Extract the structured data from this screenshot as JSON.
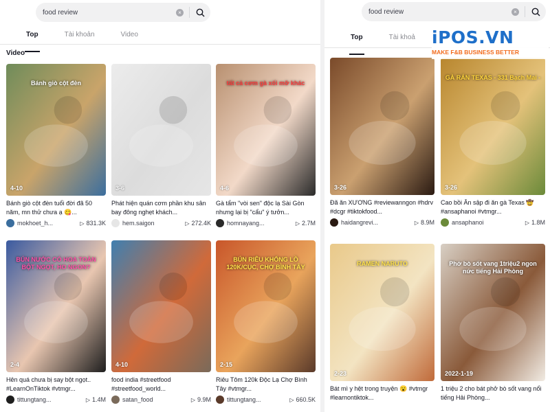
{
  "left": {
    "search": {
      "query": "food review",
      "clear_icon": "×"
    },
    "tabs": [
      "Top",
      "Tài khoản",
      "Video"
    ],
    "section_title": "Video",
    "cards": [
      {
        "duration": "4-10",
        "overlay": "Bánh giò cột đèn",
        "overlay_color": "#ffffff",
        "desc": "Bánh giò cột đèn tuổi đời đã 50 năm, mn thử chưa ạ 😋...",
        "author": "mokhoet_h...",
        "views": "831.3K",
        "colors": [
          "#6f8c5a",
          "#c9a46a",
          "#3b6e9e"
        ]
      },
      {
        "duration": "3-6",
        "overlay": "",
        "overlay_color": "#ffffff",
        "desc": "Phát hiện quán cơm phần khu sân bay đông nghẹt khách...",
        "author": "hem.saigon",
        "views": "272.4K",
        "colors": [
          "#ececec",
          "#dcdcdc",
          "#e6e6e6"
        ]
      },
      {
        "duration": "4-6",
        "overlay": "tất cả cơm gà xối mỡ khác",
        "overlay_color": "#ff3b3b",
        "desc": "Gà tẩm \"vòi sen\" độc lạ Sài Gòn nhưng lại bị \"cẩu\" ý tưởn...",
        "author": "homnayang...",
        "views": "2.7M",
        "colors": [
          "#b89070",
          "#f2d9c8",
          "#2a2a2a"
        ]
      },
      {
        "duration": "2-4",
        "overlay": "BÚN NƯỚC CÓ HOA TOÀN BỘT NGỌT, HO NGON?",
        "overlay_color": "#ff4fa8",
        "desc": "Hên quá chưa bị say bột ngọt.. #LearnOnTiktok #vtmgr...",
        "author": "tittungtang...",
        "views": "1.4M",
        "colors": [
          "#3a5aa0",
          "#e8c6b0",
          "#1e1e1e"
        ]
      },
      {
        "duration": "4-10",
        "overlay": "",
        "overlay_color": "#ffffff",
        "desc": "food india #streetfood #streetfood_world...",
        "author": "satan_food",
        "views": "9.9M",
        "colors": [
          "#3f7fb0",
          "#d06a3a",
          "#7a6a5a"
        ]
      },
      {
        "duration": "2-15",
        "overlay": "BÚN RIÊU KHỔNG LỒ 120K/CỤC, CHỢ BÌNH TÂY",
        "overlay_color": "#ffe14a",
        "desc": "Riêu Tôm 120k Độc Lạ Chợ Bình Tây #vtmgr...",
        "author": "tittungtang...",
        "views": "660.5K",
        "colors": [
          "#c8562a",
          "#e9a45c",
          "#5a3a2a"
        ]
      }
    ]
  },
  "right": {
    "search": {
      "query": "food review",
      "clear_icon": "×"
    },
    "tabs": [
      "Top",
      "Tài khoả"
    ],
    "cards": [
      {
        "duration": "3-26",
        "overlay": "",
        "overlay_color": "#ffffff",
        "desc": "Đã ăn XƯƠNG #reviewanngon #hdrv #dcgr #tiktokfood...",
        "author": "haidangrevi...",
        "views": "8.9M",
        "colors": [
          "#7a4a2a",
          "#caa070",
          "#2a1a12"
        ]
      },
      {
        "duration": "3-26",
        "overlay": "GÀ RÁN TEXAS - 331 Bạch Mai -",
        "overlay_color": "#ffd43b",
        "desc": "Cao bồi Ăn sập đi ăn gà Texas 🤠 #ansaphanoi #vtmgr...",
        "author": "ansaphanoi",
        "views": "1.8M",
        "colors": [
          "#b8862e",
          "#e4c27a",
          "#6b8a3a"
        ]
      },
      {
        "duration": "2-23",
        "overlay": "RAMEN NARUTO",
        "overlay_color": "#ffe14a",
        "desc": "Bát mì y hệt trong truyện 😮 #vtmgr #learnontiktok...",
        "author": "",
        "views": "",
        "colors": [
          "#e9c98a",
          "#f3e4c2",
          "#c06a3a"
        ]
      },
      {
        "duration": "2022-1-19",
        "overlay": "Phở bò sốt vang 1triệu2 ngon nức tiếng Hải Phòng",
        "overlay_color": "#ffffff",
        "desc": "1 triệu 2 cho bát phở bò sốt vang nổi tiếng Hải Phòng...",
        "author": "",
        "views": "",
        "colors": [
          "#d8cfc4",
          "#8a5a3a",
          "#f1ebe3"
        ]
      }
    ]
  },
  "brand": {
    "name": "iPOS.VN",
    "tagline": "MAKE F&B BUSINESS BETTER"
  },
  "icons": {
    "search": "search-icon",
    "play": "play-icon",
    "clear": "clear-icon"
  }
}
